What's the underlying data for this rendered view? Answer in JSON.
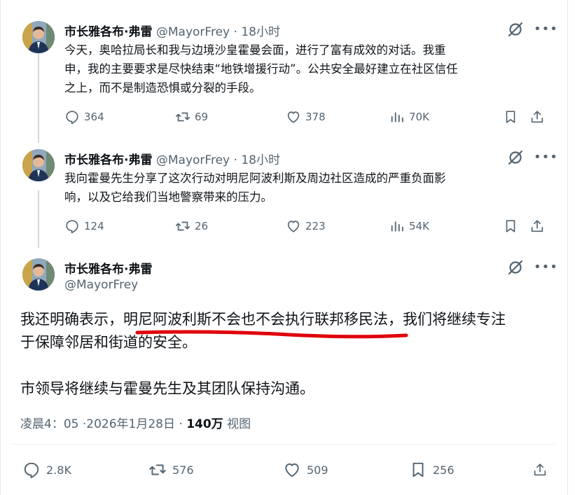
{
  "tweets": [
    {
      "author_name": "市长雅各布·弗雷",
      "handle": "@MayorFrey",
      "separator": "·",
      "time": "18小时",
      "lines": [
        "今天，奥哈拉局长和我与边境沙皇霍曼会面，进行了富有成效的对话。我重",
        "申，我的主要要求是尽快结束“地铁增援行动”。公共安全最好建立在社区信任",
        "之上，而不是制造恐惧或分裂的手段。"
      ],
      "replies": "364",
      "reposts": "69",
      "likes": "378",
      "views": "70K"
    },
    {
      "author_name": "市长雅各布·弗雷",
      "handle": "@MayorFrey",
      "separator": "·",
      "time": "18小时",
      "lines": [
        "我向霍曼先生分享了这次行动对明尼阿波利斯及周边社区造成的严重负面影",
        "响，以及它给我们当地警察带来的压力。"
      ],
      "replies": "124",
      "reposts": "26",
      "likes": "223",
      "views": "54K"
    }
  ],
  "main": {
    "author_name": "市长雅各布·弗雷",
    "handle": "@MayorFrey",
    "line1": "我还明确表示，明尼阿波利斯不会也不会执行联邦移民法，我们将继续专注",
    "line2": "于保障邻居和街道的安全。",
    "paragraph2": "市领导将继续与霍曼先生及其团队保持沟通。",
    "timestamp": "凌晨4：05 ·2026年1月28日",
    "dot": "·",
    "views_count": "140万",
    "views_label": "视图",
    "replies": "2.8K",
    "reposts": "576",
    "likes": "509",
    "bookmarks": "256",
    "underline_color": "#e0000b"
  },
  "icons": [
    "grok-icon",
    "more-icon",
    "reply-icon",
    "repost-icon",
    "like-icon",
    "views-icon",
    "bookmark-icon",
    "share-icon"
  ]
}
